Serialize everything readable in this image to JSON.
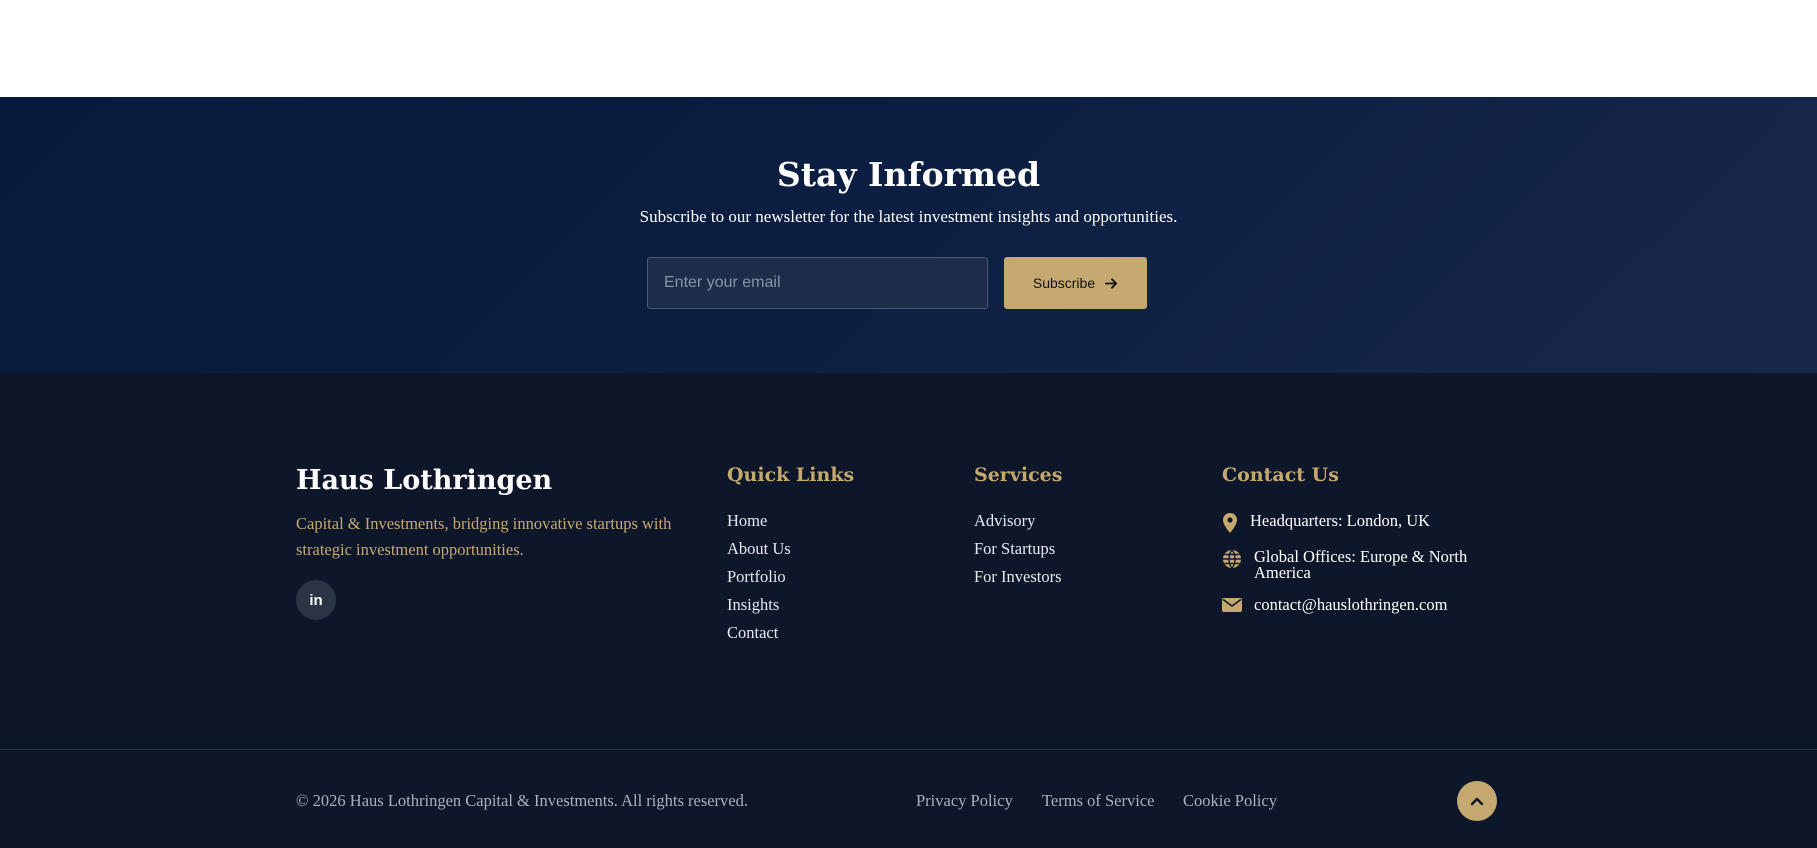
{
  "newsletter": {
    "title": "Stay Informed",
    "subtitle": "Subscribe to our newsletter for the latest investment insights and opportunities.",
    "email_placeholder": "Enter your email",
    "subscribe_label": "Subscribe",
    "subscribe_icon": "arrow-right-icon"
  },
  "brand": {
    "name": "Haus Lothringen",
    "tagline": "Capital & Investments, bridging innovative startups with strategic investment opportunities.",
    "social_label": "in",
    "social_icon": "linkedin-icon"
  },
  "quick_links": {
    "heading": "Quick Links",
    "items": [
      "Home",
      "About Us",
      "Portfolio",
      "Insights",
      "Contact"
    ]
  },
  "services": {
    "heading": "Services",
    "items": [
      "Advisory",
      "For Startups",
      "For Investors"
    ]
  },
  "contact": {
    "heading": "Contact Us",
    "headquarters": "Headquarters: London, UK",
    "offices": "Global Offices: Europe & North America",
    "email": "contact@hauslothringen.com"
  },
  "bottom": {
    "copyright": "© 2026 Haus Lothringen Capital & Investments. All rights reserved.",
    "privacy": "Privacy Policy",
    "terms": "Terms of Service",
    "cookies": "Cookie Policy",
    "back_to_top_icon": "chevron-up-icon"
  },
  "colors": {
    "gold": "#c6a971",
    "navy": "#0e1729",
    "newsletter_bg": "#071a3c"
  }
}
